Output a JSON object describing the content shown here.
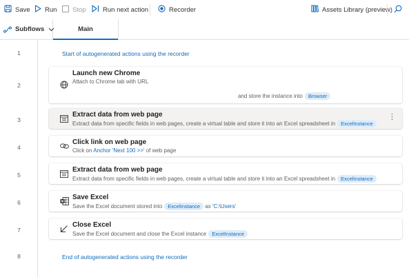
{
  "toolbar": {
    "save": "Save",
    "run": "Run",
    "stop": "Stop",
    "run_next_action": "Run next action",
    "recorder": "Recorder",
    "assets_library": "Assets Library (preview)"
  },
  "tabs": {
    "subflows": "Subflows",
    "main": "Main"
  },
  "line_numbers": [
    "1",
    "2",
    "3",
    "4",
    "5",
    "6",
    "7",
    "8"
  ],
  "comments": {
    "start": "Start of autogenerated actions using the recorder",
    "end": "End of autogenerated actions using the recorder"
  },
  "actions": {
    "launch_chrome": {
      "title": "Launch new Chrome",
      "desc": "Attach to Chrome tab with URL",
      "store_text": "and store the instance into",
      "variable": "Browser"
    },
    "extract_1": {
      "title": "Extract data from web page",
      "desc": "Extract data from specific fields in web pages, create a virtual table and store it into an Excel spreadsheet in",
      "variable": "ExcelInstance"
    },
    "click_link": {
      "title": "Click link on web page",
      "desc_prefix": "Click on",
      "anchor": "Anchor 'Next 100 >>'",
      "desc_suffix": "of web page"
    },
    "extract_2": {
      "title": "Extract data from web page",
      "desc": "Extract data from specific fields in web pages, create a virtual table and store it into an Excel spreadsheet in",
      "variable": "ExcelInstance"
    },
    "save_excel": {
      "title": "Save Excel",
      "desc": "Save the Excel document stored into",
      "variable": "ExcelInstance",
      "as_text": "as",
      "path": "'C:\\Users'"
    },
    "close_excel": {
      "title": "Close Excel",
      "desc": "Save the Excel document and close the Excel instance",
      "variable": "ExcelInstance"
    }
  },
  "more_options_glyph": "⋮",
  "colors": {
    "accent": "#0f6cbd",
    "pill_bg": "#deecf9",
    "selected_row": "#f3f2f1"
  }
}
